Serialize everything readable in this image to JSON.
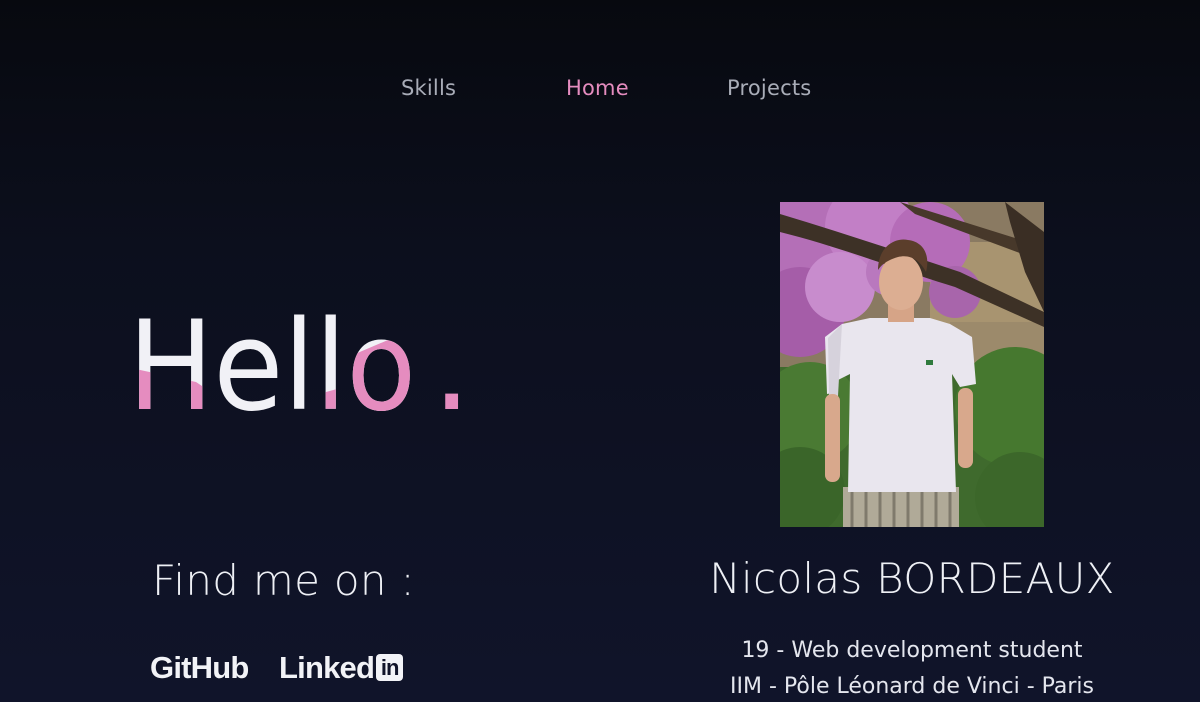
{
  "nav": {
    "skills": "Skills",
    "home": "Home",
    "projects": "Projects",
    "active": "home"
  },
  "hero": {
    "greeting": "Hello",
    "greeting_punct": "."
  },
  "profile": {
    "name": "Nicolas BORDEAUX",
    "bio_line_1": "19 - Web development student",
    "bio_line_2": "IIM - Pôle Léonard de Vinci - Paris"
  },
  "social": {
    "heading": "Find me on :",
    "github": "GitHub",
    "linkedin_text": "Linked",
    "linkedin_badge": "in"
  },
  "colors": {
    "accent": "#e58cbf",
    "background": "#0c0f1d",
    "text": "#eef0f5",
    "nav_text": "#a9adb8"
  }
}
